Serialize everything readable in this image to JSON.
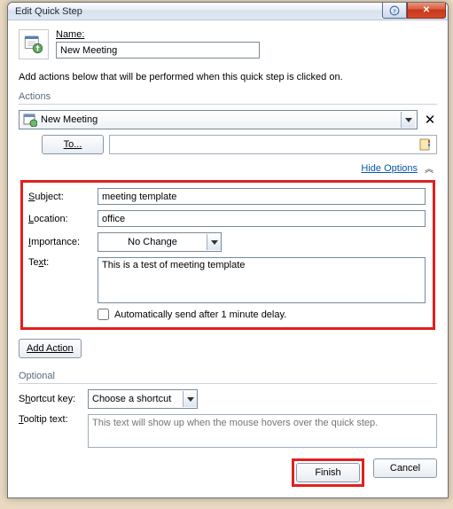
{
  "window": {
    "title": "Edit Quick Step"
  },
  "name_section": {
    "label": "Name:",
    "value": "New Meeting"
  },
  "instruction": "Add actions below that will be performed when this quick step is clicked on.",
  "sections": {
    "actions": "Actions",
    "optional": "Optional"
  },
  "action": {
    "selected": "New Meeting",
    "to_button": "To...",
    "hide_options": "Hide Options"
  },
  "fields": {
    "subject": {
      "label": "Subject:",
      "value": "meeting template"
    },
    "location": {
      "label": "Location:",
      "value": "office"
    },
    "importance": {
      "label": "Importance:",
      "value": "No Change"
    },
    "text": {
      "label": "Text:",
      "value": "This is a test of meeting template"
    },
    "auto_send": "Automatically send after 1 minute delay."
  },
  "add_action": "Add Action",
  "optional": {
    "shortcut_label": "Shortcut key:",
    "shortcut_value": "Choose a shortcut",
    "tooltip_label": "Tooltip text:",
    "tooltip_placeholder": "This text will show up when the mouse hovers over the quick step."
  },
  "buttons": {
    "finish": "Finish",
    "cancel": "Cancel"
  }
}
